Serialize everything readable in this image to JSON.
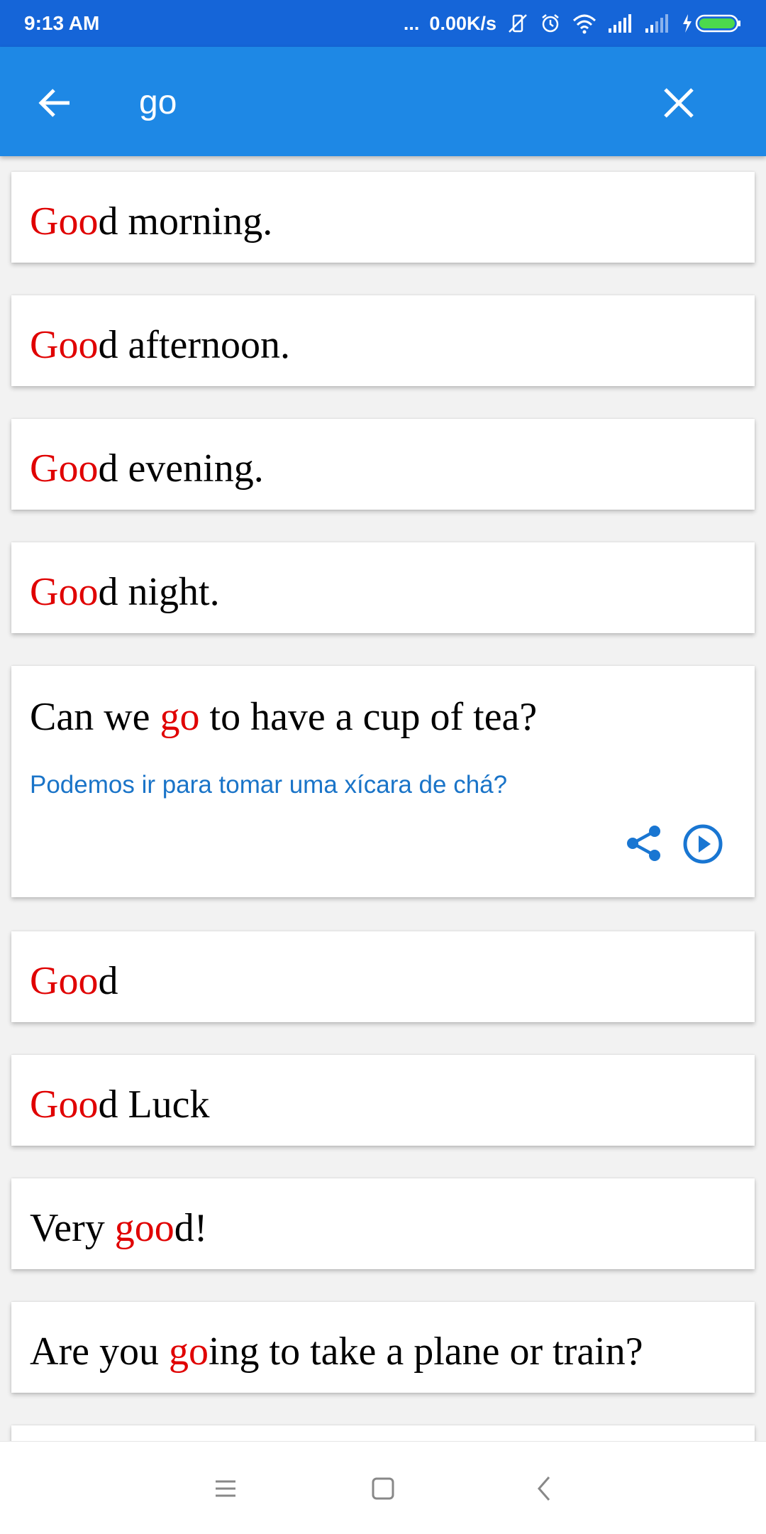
{
  "status_bar": {
    "time": "9:13 AM",
    "dots": "...",
    "speed": "0.00K/s"
  },
  "search": {
    "value": "go",
    "placeholder": ""
  },
  "results": [
    {
      "before": "",
      "match": "Goo",
      "after": "d morning."
    },
    {
      "before": "",
      "match": "Goo",
      "after": "d afternoon."
    },
    {
      "before": "",
      "match": "Goo",
      "after": "d evening."
    },
    {
      "before": "",
      "match": "Goo",
      "after": "d night."
    },
    {
      "before": "Can we ",
      "match": "go",
      "after": " to have a cup of tea?",
      "translation": "Podemos ir para tomar uma xícara de chá?"
    },
    {
      "before": "",
      "match": "Goo",
      "after": "d"
    },
    {
      "before": "",
      "match": "Goo",
      "after": "d Luck"
    },
    {
      "before": "Very ",
      "match": "goo",
      "after": "d!"
    },
    {
      "before": "Are you ",
      "match": "go",
      "after": "ing to take a plane or train?"
    }
  ],
  "colors": {
    "status_bar": "#1565d8",
    "app_bar": "#1e88e5",
    "highlight": "#e00000",
    "translation": "#1a74c8",
    "action_icons": "#1976d2"
  },
  "icons": {
    "back": "arrow-left-icon",
    "close": "close-icon",
    "share": "share-icon",
    "play": "play-circle-icon",
    "nav_menu": "menu-icon",
    "nav_home": "home-square-icon",
    "nav_back": "chevron-left-icon"
  }
}
